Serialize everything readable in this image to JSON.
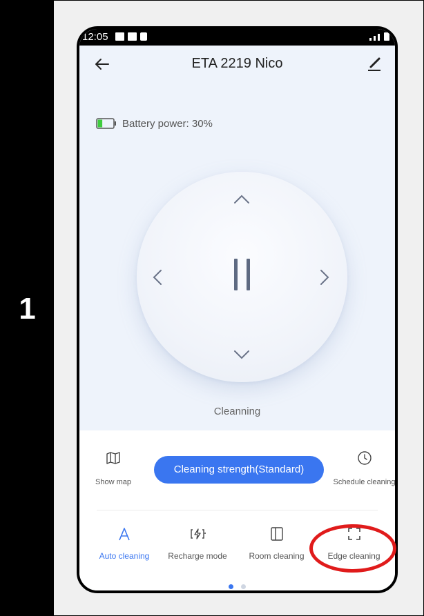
{
  "step_number": "1",
  "status_bar": {
    "time": "12:05"
  },
  "header": {
    "title": "ETA 2219 Nico"
  },
  "battery": {
    "label": "Battery power: 30%",
    "level_percent": 30,
    "color": "#3fcc3f"
  },
  "state_label": "Cleanning",
  "tools": {
    "show_map": "Show map",
    "strength_button": "Cleaning strength(Standard)",
    "schedule": "Schedule cleaning"
  },
  "modes": [
    {
      "label": "Auto cleaning",
      "icon": "letter-a-icon",
      "active": true
    },
    {
      "label": "Recharge mode",
      "icon": "charge-icon",
      "active": false
    },
    {
      "label": "Room cleaning",
      "icon": "room-icon",
      "active": false
    },
    {
      "label": "Edge cleaning",
      "icon": "edge-icon",
      "active": false
    }
  ],
  "pager": {
    "current": 1,
    "total": 2
  },
  "colors": {
    "accent": "#3a76f0",
    "highlight": "#e01b1b"
  }
}
